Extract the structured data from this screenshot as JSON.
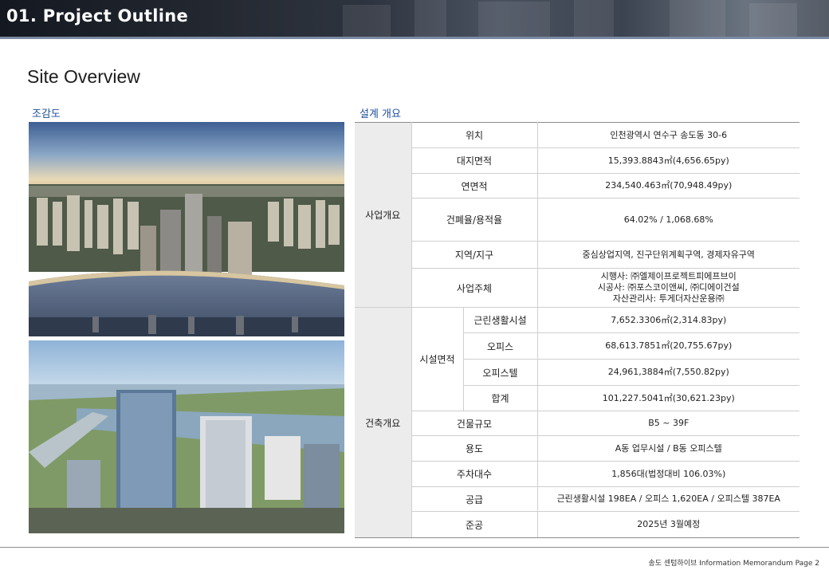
{
  "header": {
    "title": "01. Project Outline"
  },
  "section_title": "Site Overview",
  "left_label": "조감도",
  "right_label": "설계 개요",
  "table": {
    "group_business": "사업개요",
    "group_building": "건축개요",
    "subgroup_facility_area": "시설면적",
    "rows": [
      {
        "label": "위치",
        "value": "인천광역시 연수구 송도동 30-6"
      },
      {
        "label": "대지면적",
        "value": "15,393.8843㎡(4,656.65py)"
      },
      {
        "label": "연면적",
        "value": "234,540.463㎡(70,948.49py)"
      },
      {
        "label": "건폐율/용적율",
        "value": "64.02% / 1,068.68%"
      },
      {
        "label": "지역/지구",
        "value": "중심상업지역, 진구단위계획구역, 경제자유구역"
      },
      {
        "label": "사업주체",
        "value_lines": [
          "시행사: ㈜엘제이프로젝트피에프브이",
          "시공사: ㈜포스코이앤씨, ㈜디에이건설",
          "자산관리사: 투게더자산운용㈜"
        ]
      }
    ],
    "facility_rows": [
      {
        "label": "근린생활시설",
        "value": "7,652.3306㎡(2,314.83py)"
      },
      {
        "label": "오피스",
        "value": "68,613.7851㎡(20,755.67py)"
      },
      {
        "label": "오피스텔",
        "value": "24,961,3884㎡(7,550.82py)"
      },
      {
        "label": "합계",
        "value": "101,227.5041㎡(30,621.23py)"
      }
    ],
    "building_rows": [
      {
        "label": "건물규모",
        "value": "B5 ~ 39F"
      },
      {
        "label": "용도",
        "value": "A동 업무시설 / B동 오피스텔"
      },
      {
        "label": "주차대수",
        "value": "1,856대(법정대비 106.03%)"
      },
      {
        "label": "공급",
        "value": "근린생활시설 198EA / 오피스 1,620EA / 오피스텔 387EA"
      },
      {
        "label": "준공",
        "value": "2025년 3월예정"
      }
    ]
  },
  "footer": {
    "text": "송도 센텀하이브 Information Memorandum  Page 2"
  }
}
